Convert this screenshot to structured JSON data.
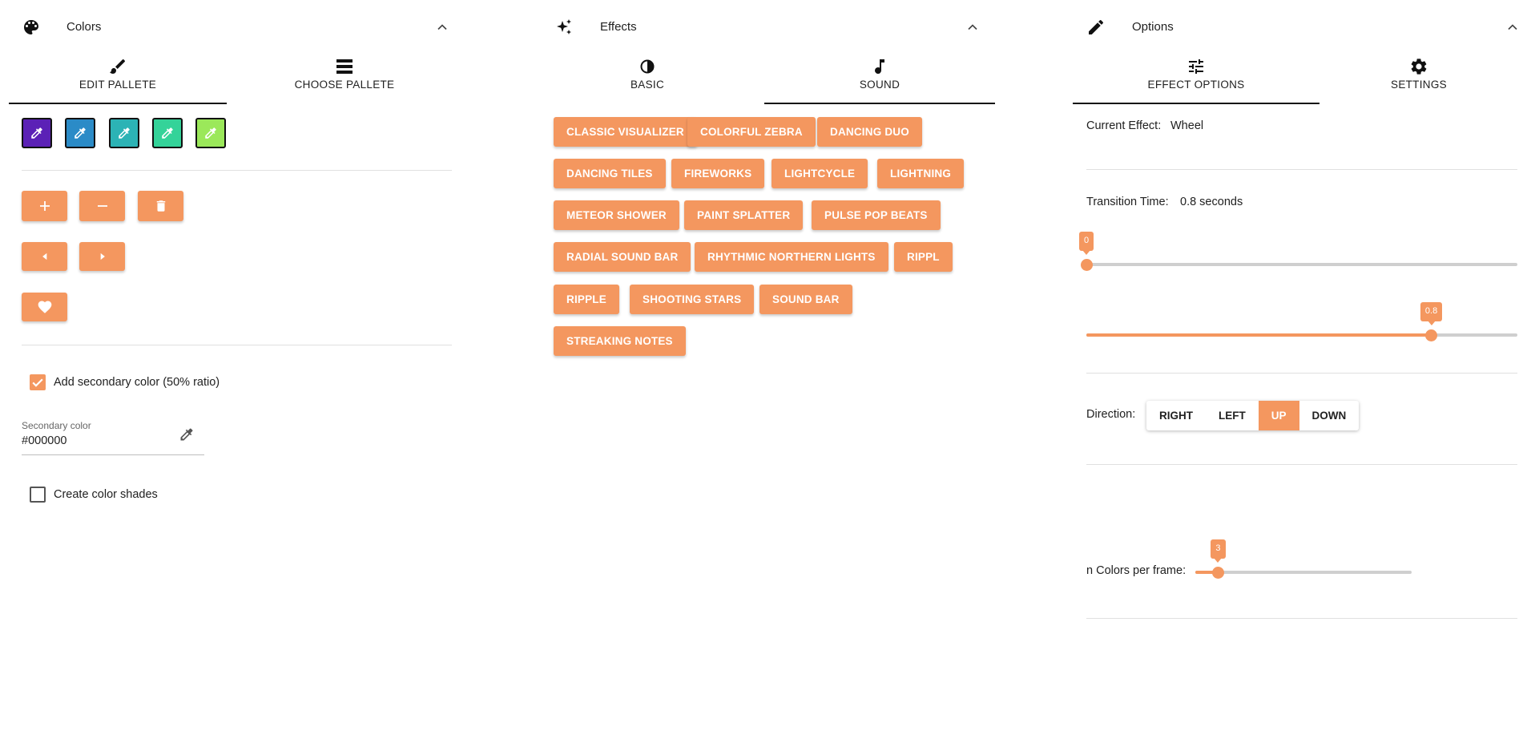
{
  "colors_panel": {
    "title": "Colors",
    "icon": "palette-icon",
    "tabs": [
      {
        "label": "EDIT PALLETE",
        "icon": "brush-icon",
        "active": true
      },
      {
        "label": "CHOOSE PALLETE",
        "icon": "list-icon",
        "active": false
      }
    ],
    "swatches": [
      "#5b21b6",
      "#2b8bc7",
      "#2cb3b5",
      "#34d399",
      "#9be85a"
    ],
    "checkbox_secondary": {
      "label": "Add secondary color (50% ratio)",
      "checked": true
    },
    "secondary_color": {
      "label": "Secondary color",
      "value": "#000000"
    },
    "checkbox_shades": {
      "label": "Create color shades",
      "checked": false
    }
  },
  "effects_panel": {
    "title": "Effects",
    "icon": "sparkles-icon",
    "tabs": [
      {
        "label": "BASIC",
        "icon": "contrast-icon",
        "active": false
      },
      {
        "label": "SOUND",
        "icon": "music-note-icon",
        "active": true
      }
    ],
    "effects": [
      "CLASSIC VISUALIZER",
      "COLORFUL ZEBRA",
      "DANCING DUO",
      "DANCING TILES",
      "FIREWORKS",
      "LIGHTCYCLE",
      "LIGHTNING",
      "METEOR SHOWER",
      "PAINT SPLATTER",
      "PULSE POP BEATS",
      "RADIAL SOUND BAR",
      "RHYTHMIC NORTHERN LIGHTS",
      "RIPPL",
      "RIPPLE",
      "SHOOTING STARS",
      "SOUND BAR",
      "STREAKING NOTES"
    ]
  },
  "options_panel": {
    "title": "Options",
    "icon": "pencil-icon",
    "tabs": [
      {
        "label": "EFFECT OPTIONS",
        "icon": "tune-icon",
        "active": true
      },
      {
        "label": "SETTINGS",
        "icon": "gear-icon",
        "active": false
      }
    ],
    "current_effect_label": "Current Effect:",
    "current_effect_value": "Wheel",
    "transition_label": "Transition Time:",
    "transition_value": "0.8 seconds",
    "slider_start": {
      "label": "0",
      "value": 0,
      "min": 0,
      "max": 1
    },
    "slider_transition": {
      "label": "0.8",
      "value": 0.8,
      "min": 0,
      "max": 1
    },
    "direction_label": "Direction:",
    "directions": [
      "RIGHT",
      "LEFT",
      "UP",
      "DOWN"
    ],
    "direction_active": "UP",
    "colors_per_frame_label": "n Colors per frame:",
    "colors_per_frame": {
      "label": "3",
      "value": 3,
      "min": 1,
      "max": 20
    }
  },
  "colors": {
    "accent": "#f4975f",
    "text": "#212121",
    "divider": "#e0e0e0"
  }
}
